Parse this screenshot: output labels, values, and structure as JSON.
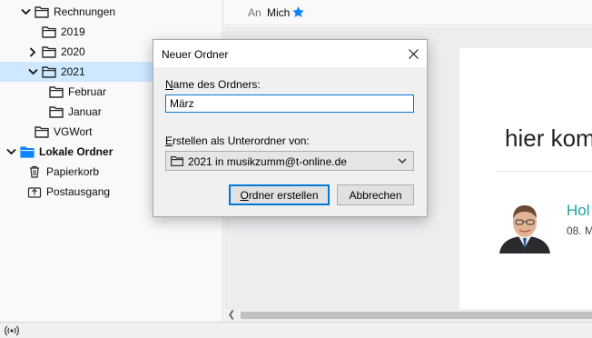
{
  "folder_tree": [
    {
      "label": "Rechnungen",
      "twisty": "expanded",
      "bold": false,
      "selected": false,
      "icon": "folder-icon"
    },
    {
      "label": "2019",
      "twisty": "none",
      "bold": false,
      "selected": false,
      "icon": "folder-icon"
    },
    {
      "label": "2020",
      "twisty": "collapsed",
      "bold": false,
      "selected": false,
      "icon": "folder-icon"
    },
    {
      "label": "2021",
      "twisty": "expanded",
      "bold": false,
      "selected": true,
      "icon": "folder-icon"
    },
    {
      "label": "Februar",
      "twisty": "none",
      "bold": false,
      "selected": false,
      "icon": "folder-icon"
    },
    {
      "label": "Januar",
      "twisty": "none",
      "bold": false,
      "selected": false,
      "icon": "folder-icon"
    },
    {
      "label": "VGWort",
      "twisty": "none",
      "bold": false,
      "selected": false,
      "icon": "folder-icon"
    },
    {
      "label": "Lokale Ordner",
      "twisty": "expanded",
      "bold": true,
      "selected": false,
      "icon": "local-folders-icon"
    },
    {
      "label": "Papierkorb",
      "twisty": "none",
      "bold": false,
      "selected": false,
      "icon": "trash-icon"
    },
    {
      "label": "Postausgang",
      "twisty": "none",
      "bold": false,
      "selected": false,
      "icon": "outbox-icon"
    }
  ],
  "message_header": {
    "to_label": "An",
    "to_name": "Mich",
    "star_color": "#0a84ff"
  },
  "email_preview": {
    "heading": "hier kom",
    "sender_name": "Hol",
    "sender_date": "08. M"
  },
  "dialog": {
    "title": "Neuer Ordner",
    "name_label_accel": "N",
    "name_label_rest": "ame des Ordners:",
    "name_value": "März",
    "parent_label_accel": "E",
    "parent_label_rest": "rstellen als Unterordner von:",
    "parent_value": "2021 in musikzumm@t-online.de",
    "create_button_accel": "O",
    "create_button_rest": "rdner erstellen",
    "cancel_button": "Abbrechen"
  },
  "colors": {
    "accent": "#0078d7",
    "selection": "#cde8ff",
    "link": "#1aa3a3"
  }
}
